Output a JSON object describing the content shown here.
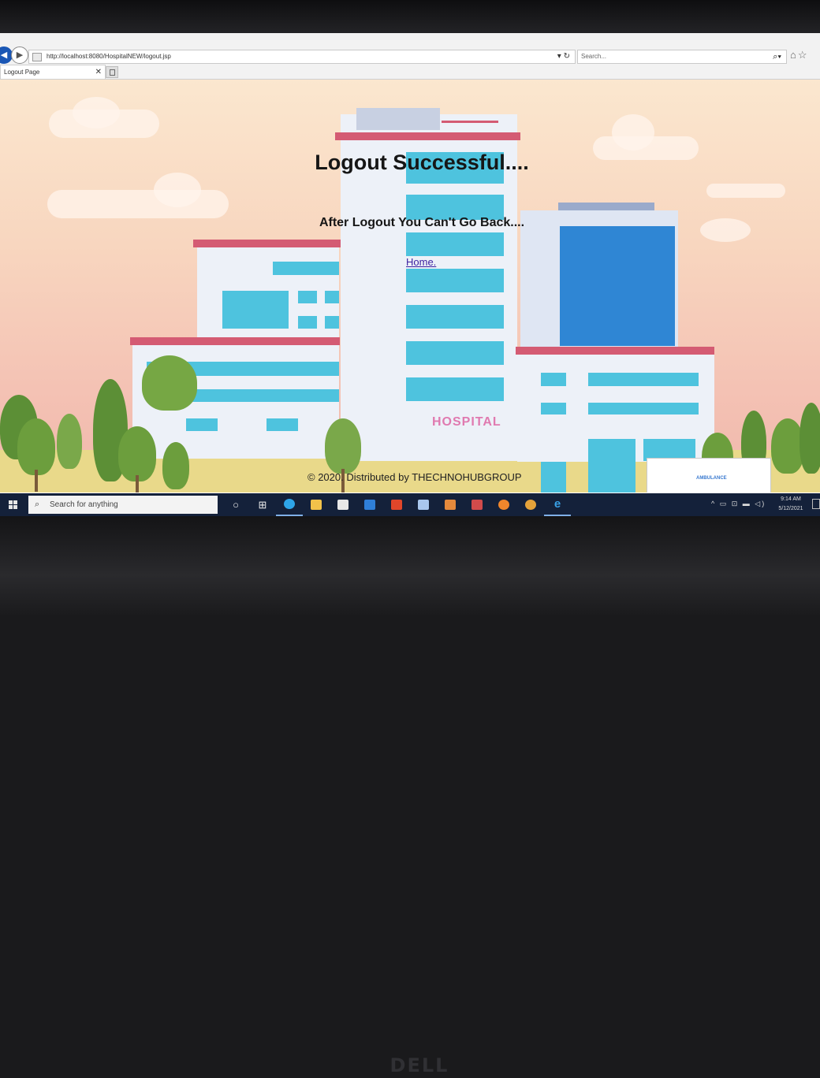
{
  "browser": {
    "url": "http://localhost:8080/HospitalNEW/logout.jsp",
    "search_placeholder": "Search...",
    "tab_title": "Logout Page"
  },
  "page": {
    "title": "Logout Successful....",
    "subtitle": "After Logout You Can't Go Back....",
    "home_link": "Home.",
    "footer": "© 2020. Distributed by THECHNOHUBGROUP",
    "hospital_sign": "HOSPITAL",
    "ambulance_label": "AMBULANCE"
  },
  "taskbar": {
    "search_placeholder": "Search for anything",
    "time": "9:14 AM",
    "date": "5/12/2021",
    "apps": [
      "task-view",
      "edge",
      "file-explorer",
      "store",
      "mail",
      "office",
      "app-cube",
      "app-orange",
      "app-grid",
      "firefox",
      "chrome",
      "internet-explorer"
    ]
  },
  "monitor": {
    "brand": "DELL"
  },
  "colors": {
    "taskbar": "#14213a",
    "roof": "#d45b73",
    "glass": "#4ec3de",
    "link": "#3b1fa0"
  }
}
